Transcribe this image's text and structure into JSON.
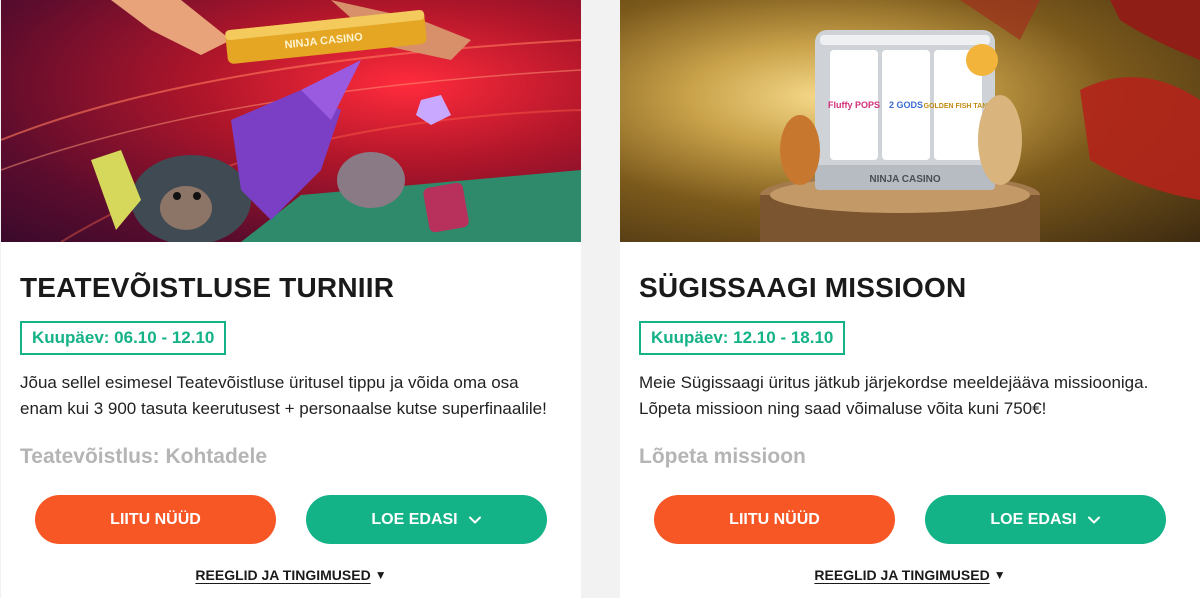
{
  "promotions": [
    {
      "banner_logo": "NINJA CASINO",
      "title": "TEATEVÕISTLUSE TURNIIR",
      "date": "Kuupäev: 06.10 - 12.10",
      "description": "Jõua sellel esimesel Teatevõistluse üritusel tippu ja võida oma osa enam kui 3 900 tasuta keerutusest + personaalse kutse superfinaalile!",
      "subheading": "Teatevõistlus: Kohtadele",
      "join_label": "LIITU NÜÜD",
      "more_label": "LOE EDASI",
      "terms_label": "REEGLID JA TINGIMUSED"
    },
    {
      "banner_logo": "NINJA CASINO",
      "slot_labels": [
        "Fluffy POPS",
        "2 GODS",
        "GOLDEN FISH TANK"
      ],
      "title": "SÜGISSAAGI MISSIOON",
      "date": "Kuupäev: 12.10 - 18.10",
      "description": "Meie Sügissaagi üritus jätkub järjekordse meeldejääva missiooniga. Lõpeta missioon ning saad võimaluse võita kuni 750€!",
      "subheading": "Lõpeta missioon",
      "join_label": "LIITU NÜÜD",
      "more_label": "LOE EDASI",
      "terms_label": "REEGLID JA TINGIMUSED"
    }
  ],
  "icons": {
    "more_chevron": "chevron-down-icon",
    "terms_caret": "caret-down-icon"
  },
  "colors": {
    "accent_green": "#14b287",
    "accent_orange": "#f75625",
    "muted_subhead": "#b5b5b5"
  }
}
